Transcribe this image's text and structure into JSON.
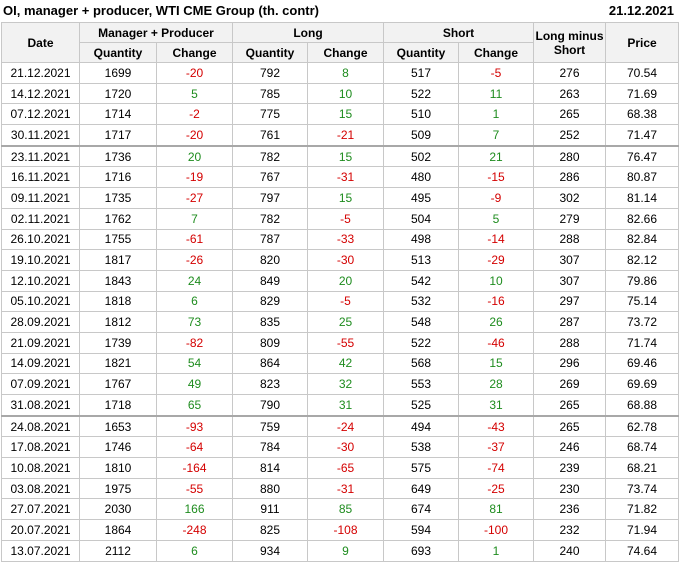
{
  "header": {
    "title": "OI, manager + producer, WTI CME Group (th. contr)",
    "date": "21.12.2021"
  },
  "columns": {
    "date": "Date",
    "group_mp": "Manager + Producer",
    "group_long": "Long",
    "group_short": "Short",
    "long_minus_short": "Long minus Short",
    "price": "Price",
    "quantity": "Quantity",
    "change": "Change"
  },
  "rows": [
    {
      "date": "21.12.2021",
      "mp_q": "1699",
      "mp_c": "-20",
      "long_q": "792",
      "long_c": "8",
      "short_q": "517",
      "short_c": "-5",
      "lms": "276",
      "price": "70.54"
    },
    {
      "date": "14.12.2021",
      "mp_q": "1720",
      "mp_c": "5",
      "long_q": "785",
      "long_c": "10",
      "short_q": "522",
      "short_c": "11",
      "lms": "263",
      "price": "71.69"
    },
    {
      "date": "07.12.2021",
      "mp_q": "1714",
      "mp_c": "-2",
      "long_q": "775",
      "long_c": "15",
      "short_q": "510",
      "short_c": "1",
      "lms": "265",
      "price": "68.38"
    },
    {
      "date": "30.11.2021",
      "mp_q": "1717",
      "mp_c": "-20",
      "long_q": "761",
      "long_c": "-21",
      "short_q": "509",
      "short_c": "7",
      "lms": "252",
      "price": "71.47"
    },
    {
      "date": "23.11.2021",
      "mp_q": "1736",
      "mp_c": "20",
      "long_q": "782",
      "long_c": "15",
      "short_q": "502",
      "short_c": "21",
      "lms": "280",
      "price": "76.47"
    },
    {
      "date": "16.11.2021",
      "mp_q": "1716",
      "mp_c": "-19",
      "long_q": "767",
      "long_c": "-31",
      "short_q": "480",
      "short_c": "-15",
      "lms": "286",
      "price": "80.87"
    },
    {
      "date": "09.11.2021",
      "mp_q": "1735",
      "mp_c": "-27",
      "long_q": "797",
      "long_c": "15",
      "short_q": "495",
      "short_c": "-9",
      "lms": "302",
      "price": "81.14"
    },
    {
      "date": "02.11.2021",
      "mp_q": "1762",
      "mp_c": "7",
      "long_q": "782",
      "long_c": "-5",
      "short_q": "504",
      "short_c": "5",
      "lms": "279",
      "price": "82.66"
    },
    {
      "date": "26.10.2021",
      "mp_q": "1755",
      "mp_c": "-61",
      "long_q": "787",
      "long_c": "-33",
      "short_q": "498",
      "short_c": "-14",
      "lms": "288",
      "price": "82.84"
    },
    {
      "date": "19.10.2021",
      "mp_q": "1817",
      "mp_c": "-26",
      "long_q": "820",
      "long_c": "-30",
      "short_q": "513",
      "short_c": "-29",
      "lms": "307",
      "price": "82.12"
    },
    {
      "date": "12.10.2021",
      "mp_q": "1843",
      "mp_c": "24",
      "long_q": "849",
      "long_c": "20",
      "short_q": "542",
      "short_c": "10",
      "lms": "307",
      "price": "79.86"
    },
    {
      "date": "05.10.2021",
      "mp_q": "1818",
      "mp_c": "6",
      "long_q": "829",
      "long_c": "-5",
      "short_q": "532",
      "short_c": "-16",
      "lms": "297",
      "price": "75.14"
    },
    {
      "date": "28.09.2021",
      "mp_q": "1812",
      "mp_c": "73",
      "long_q": "835",
      "long_c": "25",
      "short_q": "548",
      "short_c": "26",
      "lms": "287",
      "price": "73.72"
    },
    {
      "date": "21.09.2021",
      "mp_q": "1739",
      "mp_c": "-82",
      "long_q": "809",
      "long_c": "-55",
      "short_q": "522",
      "short_c": "-46",
      "lms": "288",
      "price": "71.74"
    },
    {
      "date": "14.09.2021",
      "mp_q": "1821",
      "mp_c": "54",
      "long_q": "864",
      "long_c": "42",
      "short_q": "568",
      "short_c": "15",
      "lms": "296",
      "price": "69.46"
    },
    {
      "date": "07.09.2021",
      "mp_q": "1767",
      "mp_c": "49",
      "long_q": "823",
      "long_c": "32",
      "short_q": "553",
      "short_c": "28",
      "lms": "269",
      "price": "69.69"
    },
    {
      "date": "31.08.2021",
      "mp_q": "1718",
      "mp_c": "65",
      "long_q": "790",
      "long_c": "31",
      "short_q": "525",
      "short_c": "31",
      "lms": "265",
      "price": "68.88"
    },
    {
      "date": "24.08.2021",
      "mp_q": "1653",
      "mp_c": "-93",
      "long_q": "759",
      "long_c": "-24",
      "short_q": "494",
      "short_c": "-43",
      "lms": "265",
      "price": "62.78"
    },
    {
      "date": "17.08.2021",
      "mp_q": "1746",
      "mp_c": "-64",
      "long_q": "784",
      "long_c": "-30",
      "short_q": "538",
      "short_c": "-37",
      "lms": "246",
      "price": "68.74"
    },
    {
      "date": "10.08.2021",
      "mp_q": "1810",
      "mp_c": "-164",
      "long_q": "814",
      "long_c": "-65",
      "short_q": "575",
      "short_c": "-74",
      "lms": "239",
      "price": "68.21"
    },
    {
      "date": "03.08.2021",
      "mp_q": "1975",
      "mp_c": "-55",
      "long_q": "880",
      "long_c": "-31",
      "short_q": "649",
      "short_c": "-25",
      "lms": "230",
      "price": "73.74"
    },
    {
      "date": "27.07.2021",
      "mp_q": "2030",
      "mp_c": "166",
      "long_q": "911",
      "long_c": "85",
      "short_q": "674",
      "short_c": "81",
      "lms": "236",
      "price": "71.82"
    },
    {
      "date": "20.07.2021",
      "mp_q": "1864",
      "mp_c": "-248",
      "long_q": "825",
      "long_c": "-108",
      "short_q": "594",
      "short_c": "-100",
      "lms": "232",
      "price": "71.94"
    },
    {
      "date": "13.07.2021",
      "mp_q": "2112",
      "mp_c": "6",
      "long_q": "934",
      "long_c": "9",
      "short_q": "693",
      "short_c": "1",
      "lms": "240",
      "price": "74.64"
    }
  ],
  "colors": {
    "positive": "#1e8c1e",
    "negative": "#d40000",
    "header_bg": "#f2f2f2",
    "grid": "#c8c8c8"
  }
}
